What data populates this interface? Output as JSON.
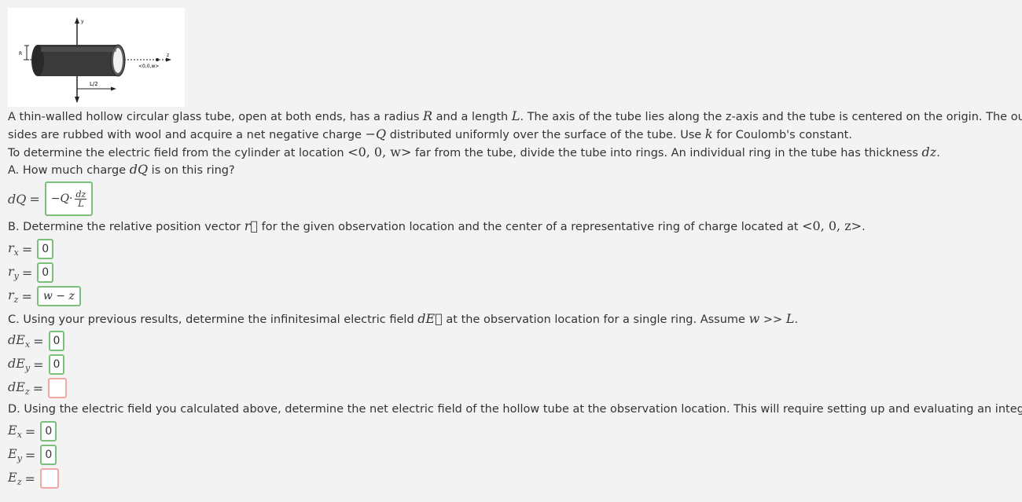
{
  "figure": {
    "y_axis_label": "y",
    "z_axis_label": "z",
    "r_label": "R",
    "length_label": "L/2",
    "point_label": "<0,0,w>"
  },
  "intro": {
    "p1_a": "A thin-walled hollow circular glass tube, open at both ends, has a radius ",
    "p1_R": "R",
    "p1_b": " and a length ",
    "p1_L": "L",
    "p1_c": ". The axis of the tube lies along the z-axis and the tube is centered on the origin. The outer",
    "p2_a": "sides are rubbed with wool and acquire a net negative charge ",
    "p2_Q": "−Q",
    "p2_b": " distributed uniformly over the surface of the tube. Use ",
    "p2_k": "k",
    "p2_c": " for Coulomb's constant.",
    "p3_a": "To determine the electric field from the cylinder at location ",
    "p3_loc": "<0, 0, w>",
    "p3_b": " far from the tube, divide the tube into rings. An individual ring in the tube has thickness ",
    "p3_dz": "dz",
    "p3_c": "."
  },
  "partA": {
    "q_a": "A. How much charge ",
    "q_dQ": "dQ",
    "q_b": " is on this ring?",
    "label": "dQ",
    "eq": "=",
    "answer_prefix": "−Q·",
    "answer_num": "dz",
    "answer_den": "L"
  },
  "partB": {
    "q_a": "B. Determine the relative position vector ",
    "q_r": "r⃗",
    "q_b": " for the given observation location and the center of a representative ring of charge located at ",
    "q_loc": "<0, 0, z>",
    "q_c": ".",
    "rows": [
      {
        "sym": "r",
        "sub": "x",
        "value": "0"
      },
      {
        "sym": "r",
        "sub": "y",
        "value": "0"
      },
      {
        "sym": "r",
        "sub": "z",
        "value": "w − z"
      }
    ]
  },
  "partC": {
    "q_a": "C. Using your previous results, determine the infinitesimal electric field ",
    "q_dE": "dE⃗",
    "q_b": " at the observation location for a single ring. Assume ",
    "q_w": "w",
    "q_c": " >> ",
    "q_L": "L",
    "q_d": ".",
    "rows": [
      {
        "sym": "dE",
        "sub": "x",
        "value": "0"
      },
      {
        "sym": "dE",
        "sub": "y",
        "value": "0"
      },
      {
        "sym": "dE",
        "sub": "z",
        "value": ""
      }
    ]
  },
  "partD": {
    "q": "D. Using the electric field you calculated above, determine the net electric field of the hollow tube at the observation location. This will require setting up and evaluating an integral.",
    "rows": [
      {
        "sym": "E",
        "sub": "x",
        "value": "0"
      },
      {
        "sym": "E",
        "sub": "y",
        "value": "0"
      },
      {
        "sym": "E",
        "sub": "z",
        "value": ""
      }
    ]
  },
  "colors": {
    "correct_border": "#7bbf7b",
    "incorrect_border": "#f2a6a6",
    "background": "#f3f3f3"
  }
}
